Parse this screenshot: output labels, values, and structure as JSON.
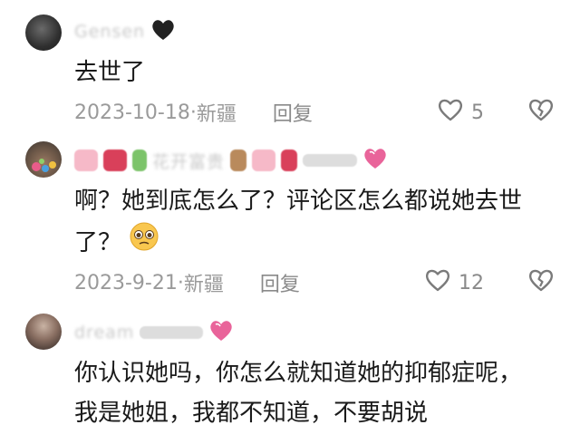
{
  "comments": [
    {
      "username": "Gensen",
      "text": "去世了",
      "date": "2023-10-18",
      "location": "新疆",
      "reply_label": "回复",
      "likes": "5"
    },
    {
      "username": "花开富贵",
      "text_line1": "啊？她到底怎么了？评论区怎么都说她去世",
      "text_line2": "了？",
      "date": "2023-9-21",
      "location": "新疆",
      "reply_label": "回复",
      "likes": "12"
    },
    {
      "username": "dream",
      "text_line1": "你认识她吗，你怎么就知道她的抑郁症呢，",
      "text_line2": "我是她姐，我都不知道，不要胡说"
    }
  ],
  "separator": " · ",
  "colors": {
    "text": "#1a1a1a",
    "meta": "#9a9a9a",
    "heart_pink": "#e9649a"
  }
}
